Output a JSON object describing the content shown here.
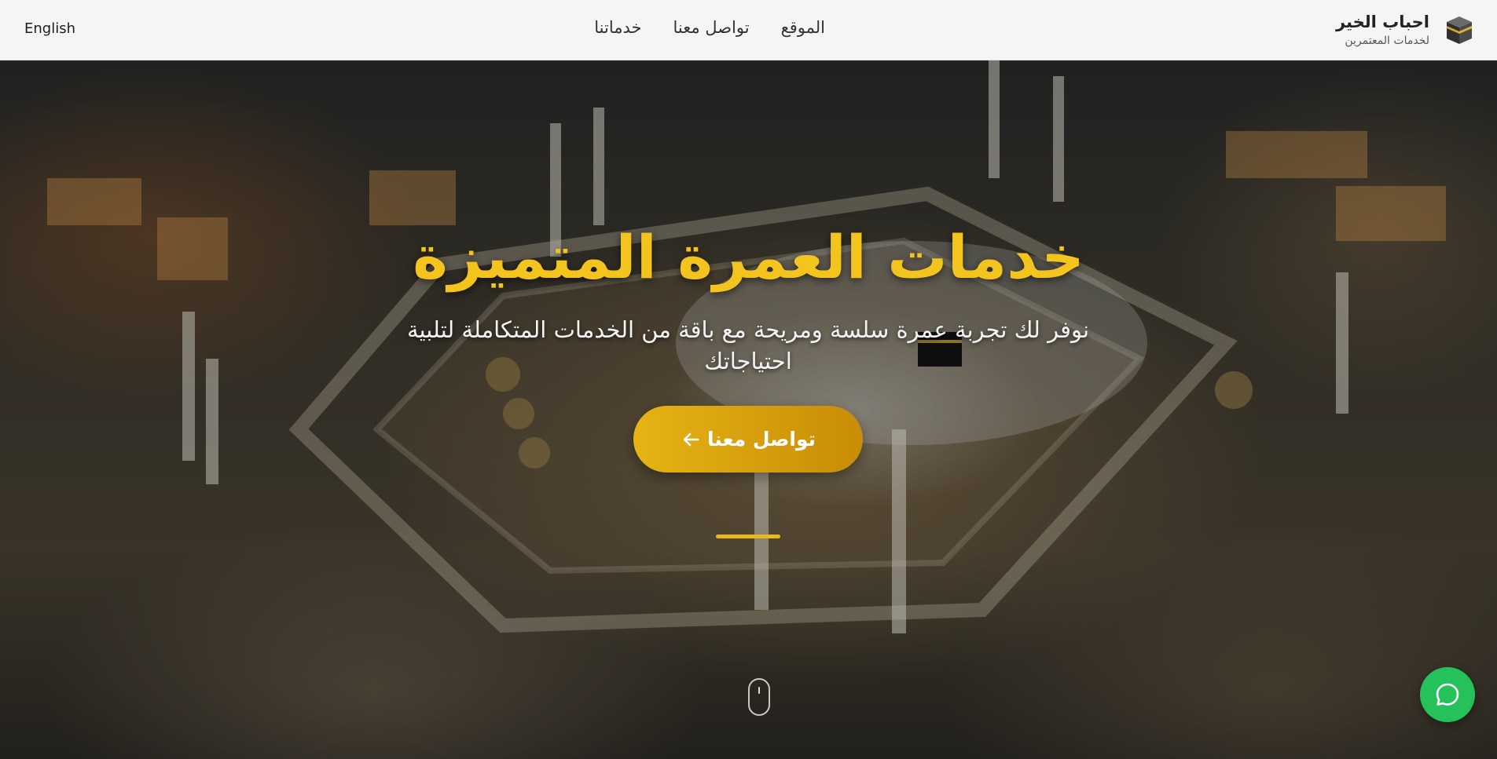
{
  "header": {
    "language_toggle": "English",
    "nav": {
      "items": [
        {
          "label": "الموقع"
        },
        {
          "label": "تواصل معنا"
        },
        {
          "label": "خدماتنا"
        }
      ]
    },
    "brand": {
      "title": "احباب الخير",
      "subtitle": "لخدمات المعتمرين",
      "logo_icon": "kaaba-icon"
    }
  },
  "hero": {
    "title": "خدمات العمرة المتميزة",
    "subtitle": "نوفر لك تجربة عمرة سلسة ومريحة مع باقة من الخدمات المتكاملة لتلبية احتياجاتك",
    "cta": {
      "label": "تواصل معنا",
      "icon": "arrow-left-icon"
    },
    "background": "aerial-night-view-masjid-al-haram"
  },
  "widgets": {
    "whatsapp_icon": "whatsapp-icon",
    "scroll_icon": "mouse-scroll-icon"
  },
  "colors": {
    "accent": "#f3c31e",
    "cta_gradient_start": "#e6b414",
    "cta_gradient_end": "#c88c06",
    "whatsapp": "#25c15a",
    "header_bg": "#f5f5f5"
  }
}
